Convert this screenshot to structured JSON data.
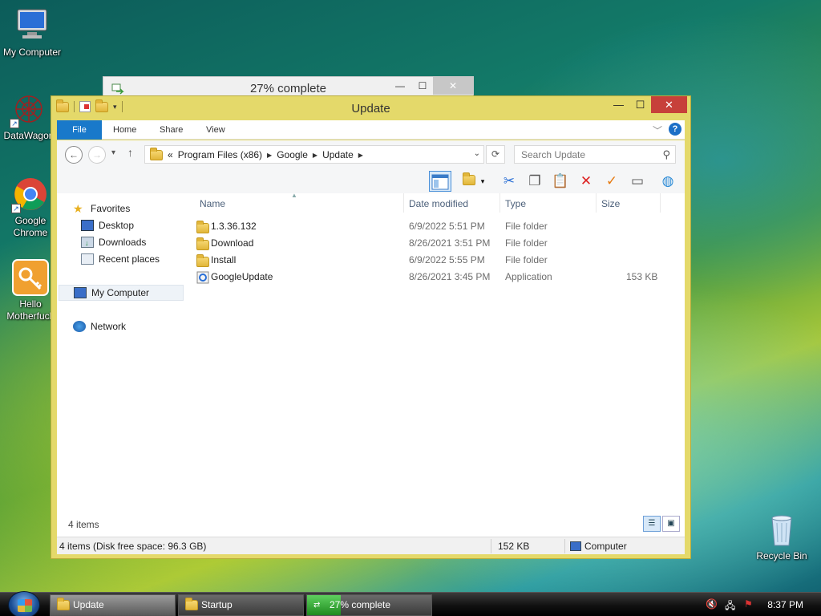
{
  "desktop": {
    "icons": [
      {
        "label": "My Computer"
      },
      {
        "label": "DataWagon"
      },
      {
        "label": "Google Chrome"
      },
      {
        "label": "Hello Motherfuck"
      },
      {
        "label": "Recycle Bin"
      }
    ]
  },
  "back_window": {
    "title": "27% complete",
    "minimize": "—",
    "maximize": "☐",
    "close": "✕"
  },
  "window": {
    "title": "Update",
    "minimize": "—",
    "maximize": "☐",
    "close": "✕"
  },
  "ribbon": {
    "tabs": [
      "File",
      "Home",
      "Share",
      "View"
    ]
  },
  "address": {
    "prefix": "«",
    "segments": [
      "Program Files (x86)",
      "Google",
      "Update"
    ],
    "search_placeholder": "Search Update"
  },
  "nav_pane": {
    "favorites": "Favorites",
    "desktop": "Desktop",
    "downloads": "Downloads",
    "recent_places": "Recent places",
    "my_computer": "My Computer",
    "network": "Network"
  },
  "list": {
    "columns": [
      "Name",
      "Date modified",
      "Type",
      "Size"
    ],
    "rows": [
      {
        "name": "1.3.36.132",
        "date": "6/9/2022 5:51 PM",
        "type": "File folder",
        "size": "",
        "icon": "folder-icon"
      },
      {
        "name": "Download",
        "date": "8/26/2021 3:51 PM",
        "type": "File folder",
        "size": "",
        "icon": "folder-icon"
      },
      {
        "name": "Install",
        "date": "6/9/2022 5:55 PM",
        "type": "File folder",
        "size": "",
        "icon": "folder-icon"
      },
      {
        "name": "GoogleUpdate",
        "date": "8/26/2021 3:45 PM",
        "type": "Application",
        "size": "153 KB",
        "icon": "application-icon"
      }
    ],
    "item_count": "4 items"
  },
  "statusbar": {
    "left": "4 items (Disk free space: 96.3 GB)",
    "size": "152 KB",
    "location": "Computer"
  },
  "taskbar": {
    "tasks": [
      {
        "label": "Update"
      },
      {
        "label": "Startup"
      },
      {
        "label": "27% complete",
        "progress": 0.27
      }
    ],
    "clock": "8:37 PM"
  },
  "colors": {
    "window_frame": "#e4d96a",
    "file_tab": "#1979ca",
    "close_button": "#c7403a"
  }
}
